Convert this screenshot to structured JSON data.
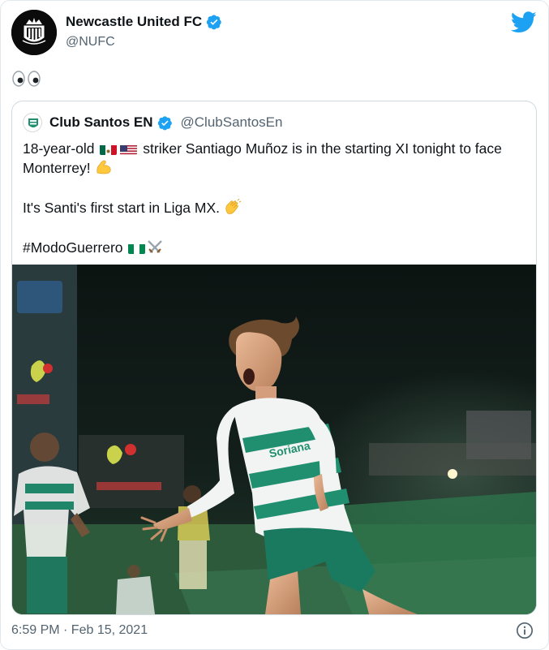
{
  "author": {
    "display_name": "Newcastle United FC",
    "handle": "@NUFC"
  },
  "tweet_text": "👀",
  "quoted": {
    "display_name": "Club Santos EN",
    "handle": "@ClubSantosEn",
    "line1_pre": "18-year-old",
    "line1_post": "striker Santiago Muñoz is in the starting XI tonight to face Monterrey!",
    "line1_emoji": "💪",
    "line2": "It's Santi's first start in Liga MX.",
    "line2_emoji": "👏",
    "line3": "#ModoGuerrero",
    "line3_emoji": "⚔️"
  },
  "timestamp": "6:59 PM · Feb 15, 2021",
  "icons": {
    "verified": "verified-badge-icon",
    "brand": "twitter-bird-icon",
    "info": "info-icon"
  },
  "colors": {
    "brand_blue": "#1da1f2",
    "santos_green": "#1f8f6f",
    "secondary_text": "#536471"
  }
}
